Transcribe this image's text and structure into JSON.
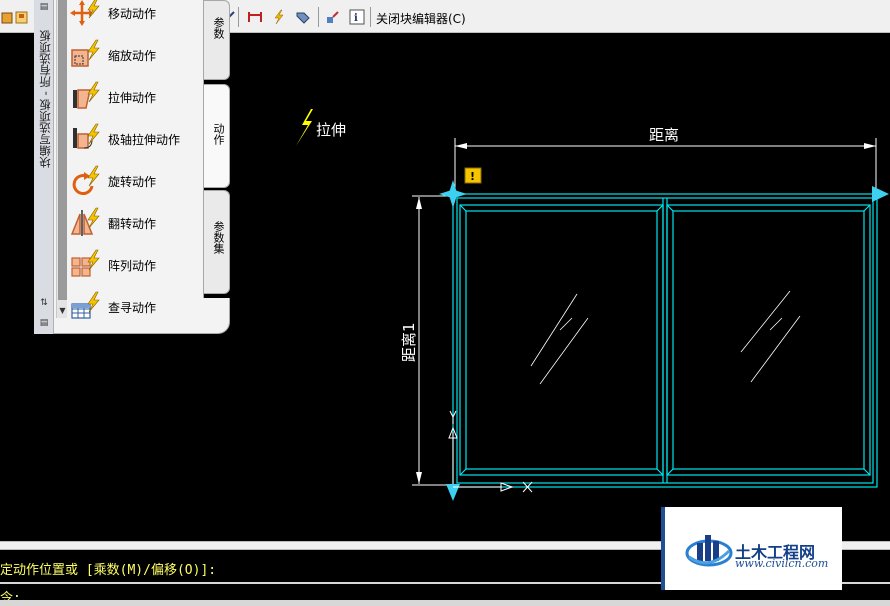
{
  "toolbar": {
    "close_label": "关闭块编辑器(C)",
    "icons": [
      "block-editor-icon",
      "save-block-icon",
      "parameter-icon",
      "action-icon",
      "visibility-icon",
      "attribute-icon",
      "info-icon"
    ]
  },
  "palette": {
    "title": "块编写选项板 - 所有选项板",
    "items": [
      {
        "label": "移动动作",
        "icon": "move-action-icon"
      },
      {
        "label": "缩放动作",
        "icon": "scale-action-icon"
      },
      {
        "label": "拉伸动作",
        "icon": "stretch-action-icon"
      },
      {
        "label": "极轴拉伸动作",
        "icon": "polar-stretch-action-icon"
      },
      {
        "label": "旋转动作",
        "icon": "rotate-action-icon"
      },
      {
        "label": "翻转动作",
        "icon": "flip-action-icon"
      },
      {
        "label": "阵列动作",
        "icon": "array-action-icon"
      },
      {
        "label": "查寻动作",
        "icon": "lookup-action-icon"
      }
    ],
    "tabs": [
      {
        "label": "参数",
        "active": false
      },
      {
        "label": "动作",
        "active": true
      },
      {
        "label": "参数集",
        "active": false
      }
    ]
  },
  "drawing": {
    "action_label": "拉伸",
    "dim_horizontal": "距离",
    "dim_vertical": "距离1",
    "frame_color": "#00e5ee",
    "grip_color": "#3dd0f0",
    "warning_color": "#f5c400"
  },
  "command": {
    "line1": "定动作位置或 [乘数(M)/偏移(O)]:",
    "line2": "令:"
  },
  "watermark": {
    "title": "土木工程网",
    "url": "www.civilcn.com"
  }
}
